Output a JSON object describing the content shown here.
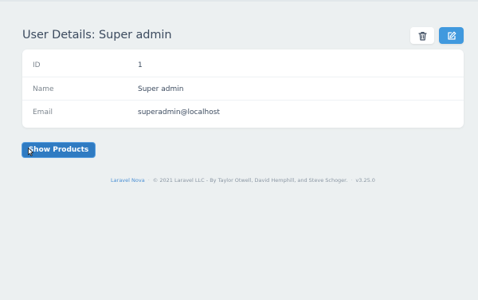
{
  "header": {
    "title": "User Details: Super admin"
  },
  "actions": {
    "delete_icon": "trash-icon",
    "edit_icon": "edit-icon"
  },
  "details": {
    "rows": [
      {
        "label": "ID",
        "value": "1"
      },
      {
        "label": "Name",
        "value": "Super admin"
      },
      {
        "label": "Email",
        "value": "superadmin@localhost"
      }
    ]
  },
  "show_products_button": {
    "label": "Show Products"
  },
  "footer": {
    "link_text": "Laravel Nova",
    "separator": "·",
    "credits": "© 2021 Laravel LLC - By Taylor Otwell, David Hemphill, and Steve Schoger.",
    "version": "v3.25.0"
  },
  "colors": {
    "background": "#ecf0f1",
    "primary": "#4099de",
    "primary_dark": "#2f7bc2",
    "text": "#3c4b5f",
    "muted": "#7c858e"
  }
}
